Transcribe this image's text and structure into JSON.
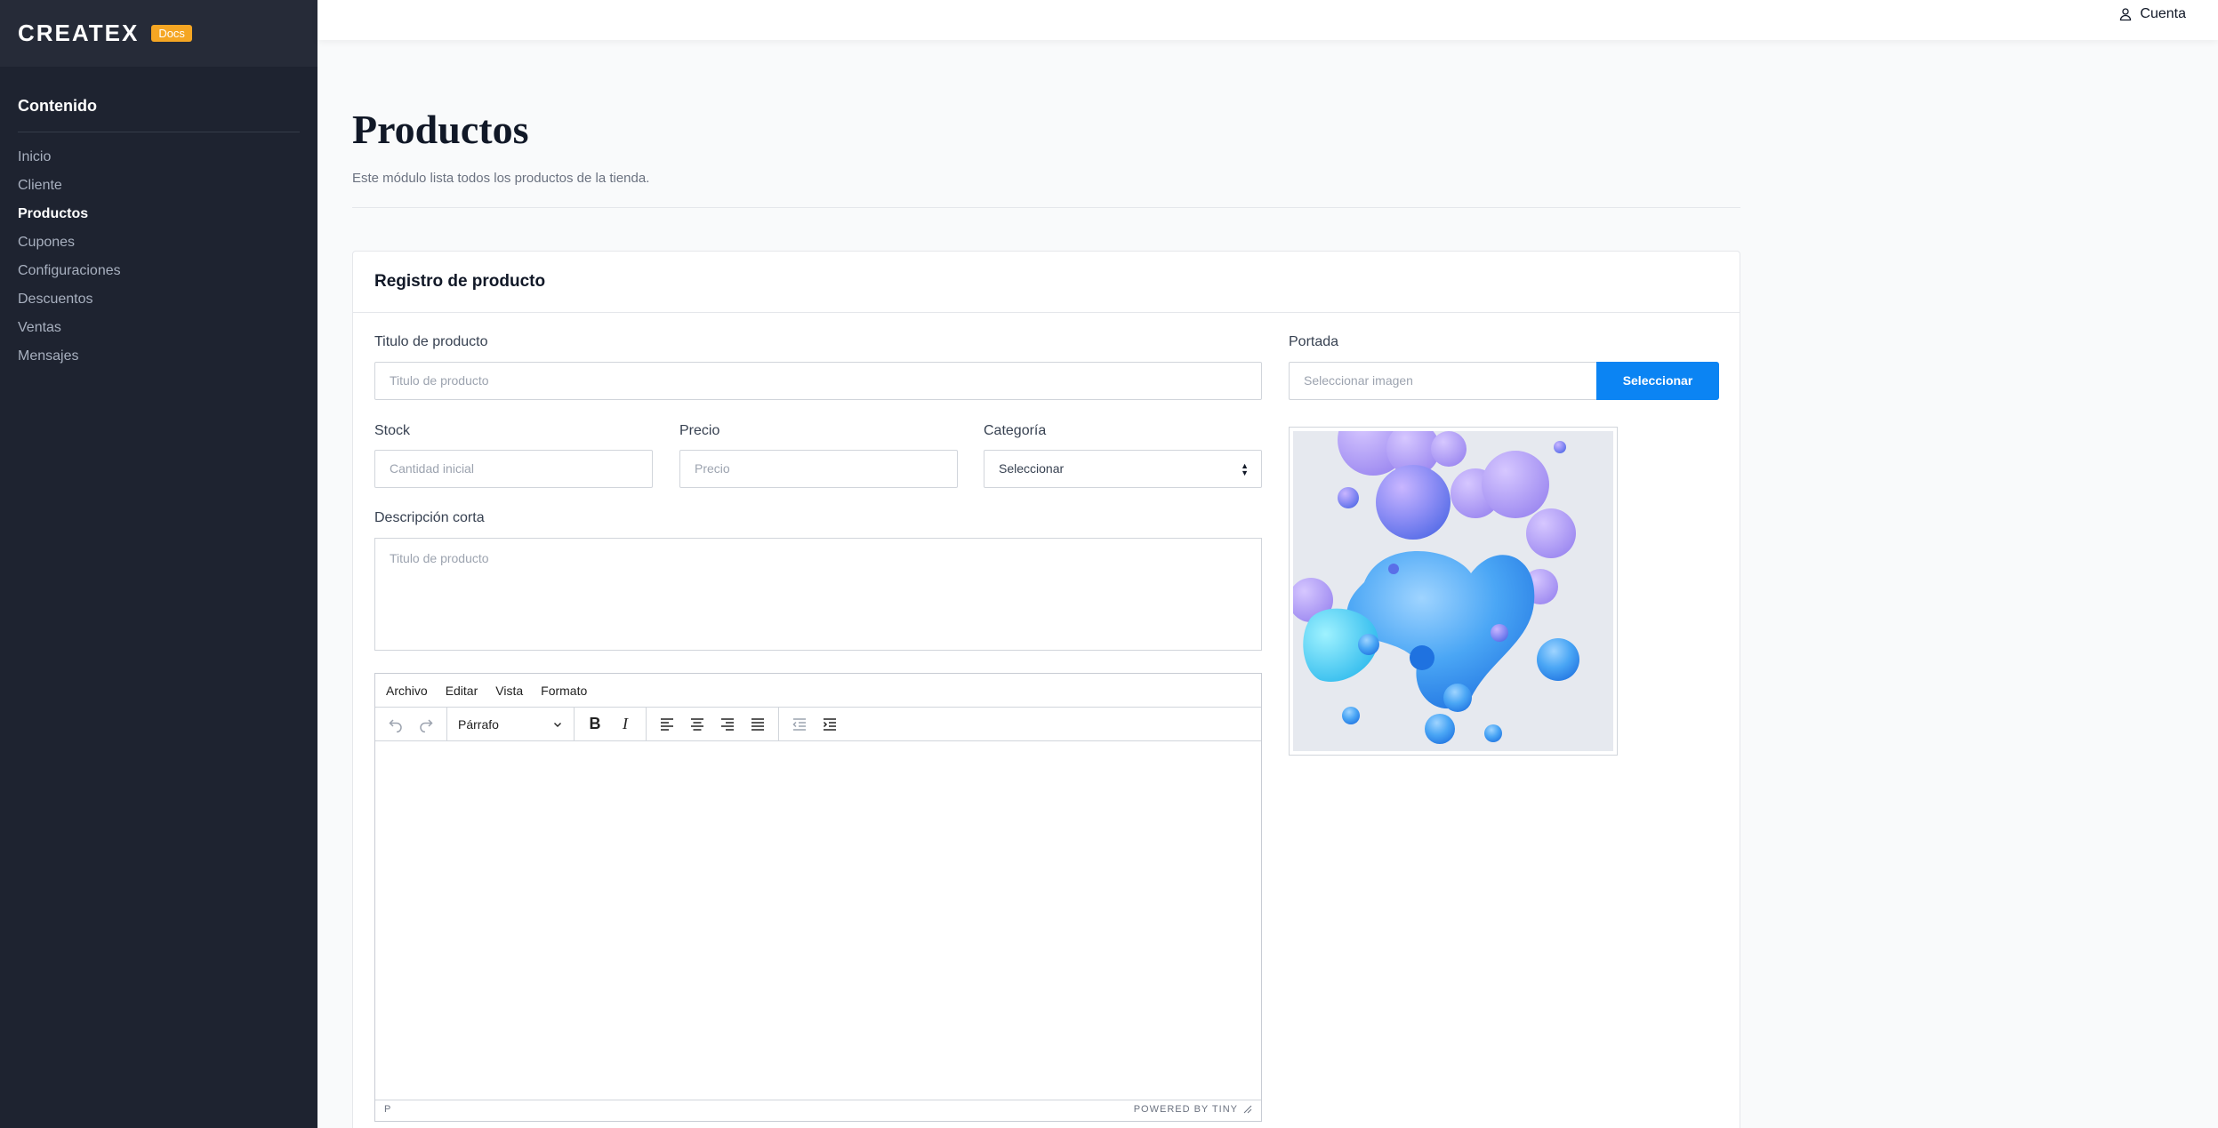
{
  "sidebar": {
    "logo": "CREATEX",
    "badge": "Docs",
    "heading": "Contenido",
    "items": [
      {
        "label": "Inicio"
      },
      {
        "label": "Cliente"
      },
      {
        "label": "Productos",
        "active": true
      },
      {
        "label": "Cupones"
      },
      {
        "label": "Configuraciones"
      },
      {
        "label": "Descuentos"
      },
      {
        "label": "Ventas"
      },
      {
        "label": "Mensajes"
      }
    ]
  },
  "topbar": {
    "account_label": "Cuenta",
    "account_icon": "user-icon"
  },
  "page": {
    "title": "Productos",
    "subtitle": "Este módulo lista todos los productos de la tienda."
  },
  "form": {
    "card_title": "Registro de producto",
    "title_label": "Titulo de producto",
    "title_placeholder": "Titulo de producto",
    "stock_label": "Stock",
    "stock_placeholder": "Cantidad inicial",
    "price_label": "Precio",
    "price_placeholder": "Precio",
    "category_label": "Categoría",
    "category_value": "Seleccionar",
    "short_desc_label": "Descripción corta",
    "short_desc_placeholder": "Titulo de producto",
    "cover_label": "Portada",
    "cover_placeholder": "Seleccionar imagen",
    "cover_button": "Seleccionar"
  },
  "editor": {
    "menu": [
      "Archivo",
      "Editar",
      "Vista",
      "Formato"
    ],
    "block_format": "Párrafo",
    "status_path": "P",
    "powered_by": "POWERED BY TINY"
  },
  "colors": {
    "sidebar_bg": "#1e2330",
    "accent": "#0b84f3",
    "badge": "#f5a623"
  }
}
